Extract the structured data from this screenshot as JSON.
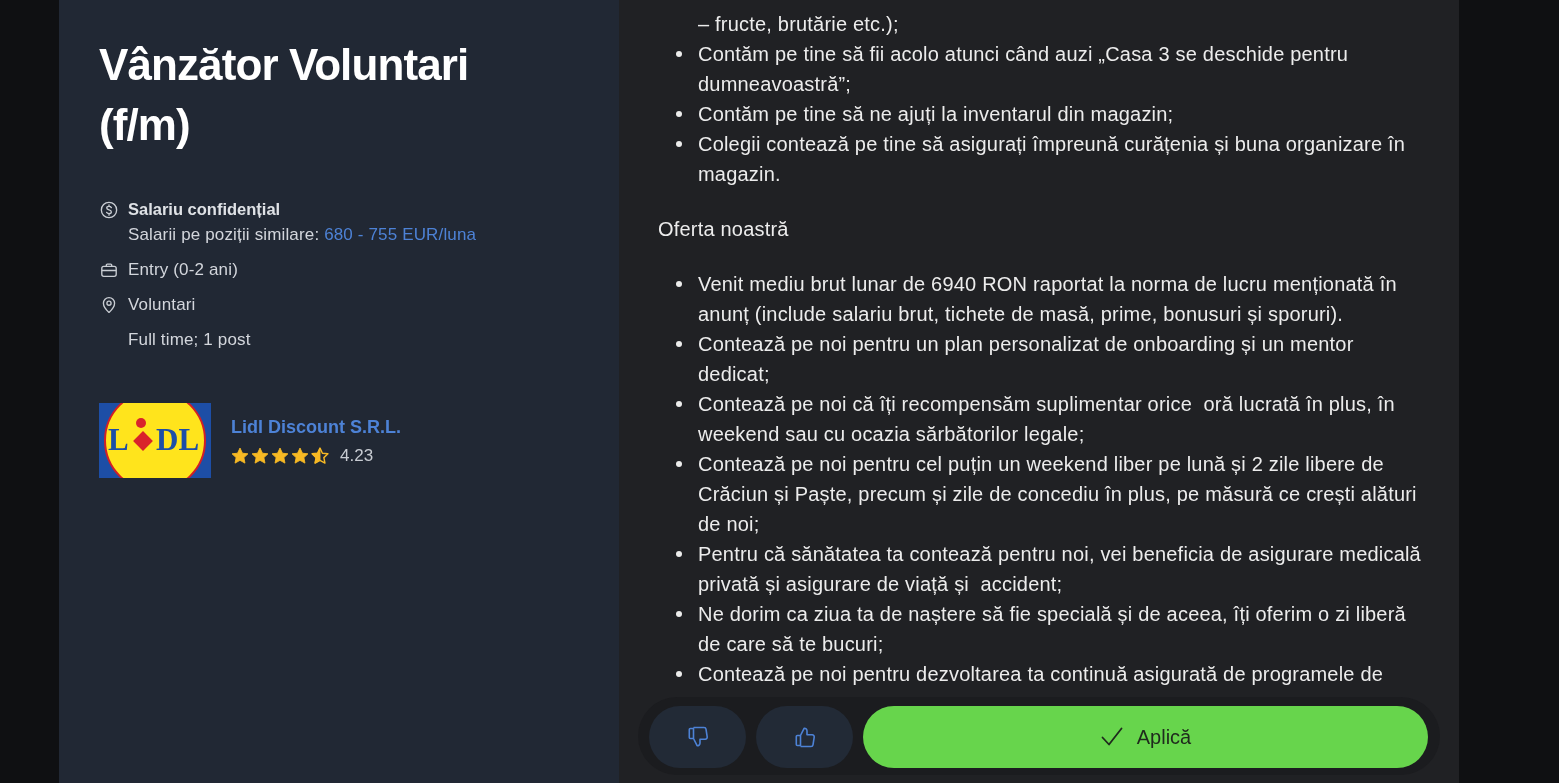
{
  "job": {
    "title": "Vânzător Voluntari (f/m)",
    "salary": {
      "label": "Salariu confidențial",
      "similar_label": "Salarii pe poziții similare:",
      "similar_range": "680 - 755 EUR/luna"
    },
    "experience": "Entry (0-2 ani)",
    "location": "Voluntari",
    "schedule": "Full time; 1 post"
  },
  "company": {
    "logo": {
      "text_before_mark": "L",
      "text_after_mark": "DL"
    },
    "name": "Lidl Discount S.R.L.",
    "stars": 4.5,
    "rating": "4.23"
  },
  "description": [
    {
      "kind": "continuation",
      "text": "– fructe, brutărie etc.);"
    },
    {
      "kind": "list",
      "items": [
        "Contăm pe tine să fii acolo atunci când auzi „Casa 3 se deschide pentru dumneavoastră”;",
        "Contăm pe tine să ne ajuți la inventarul din magazin;",
        "Colegii contează pe tine să asigurați împreună curățenia și buna organizare în magazin."
      ]
    },
    {
      "kind": "heading",
      "text": "Oferta noastră"
    },
    {
      "kind": "list",
      "items": [
        "Venit mediu brut lunar de 6940 RON raportat la norma de lucru menționată în anunț (include salariu brut, tichete de masă, prime, bonusuri și sporuri).",
        "Contează pe noi pentru un plan personalizat de onboarding și un mentor dedicat;",
        "Contează pe noi că îți recompensăm suplimentar orice  oră lucrată în plus, în weekend sau cu ocazia sărbătorilor legale;",
        "Contează pe noi pentru cel puțin un weekend liber pe lună și 2 zile libere de Crăciun și Paște, precum și zile de concediu în plus, pe măsură ce crești alături de noi;",
        "Pentru că sănătatea ta contează pentru noi, vei beneficia de asigurare medicală privată și asigurare de viață și  accident;",
        "Ne dorim ca ziua ta de naștere să fie specială și de aceea, îți oferim o zi liberă de care să te bucuri;",
        "Contează pe noi pentru dezvoltarea ta continuă asigurată de programele de"
      ]
    }
  ],
  "actions": [
    {
      "kind": "dislike"
    },
    {
      "kind": "like"
    },
    {
      "kind": "apply",
      "label": "Aplică"
    }
  ]
}
